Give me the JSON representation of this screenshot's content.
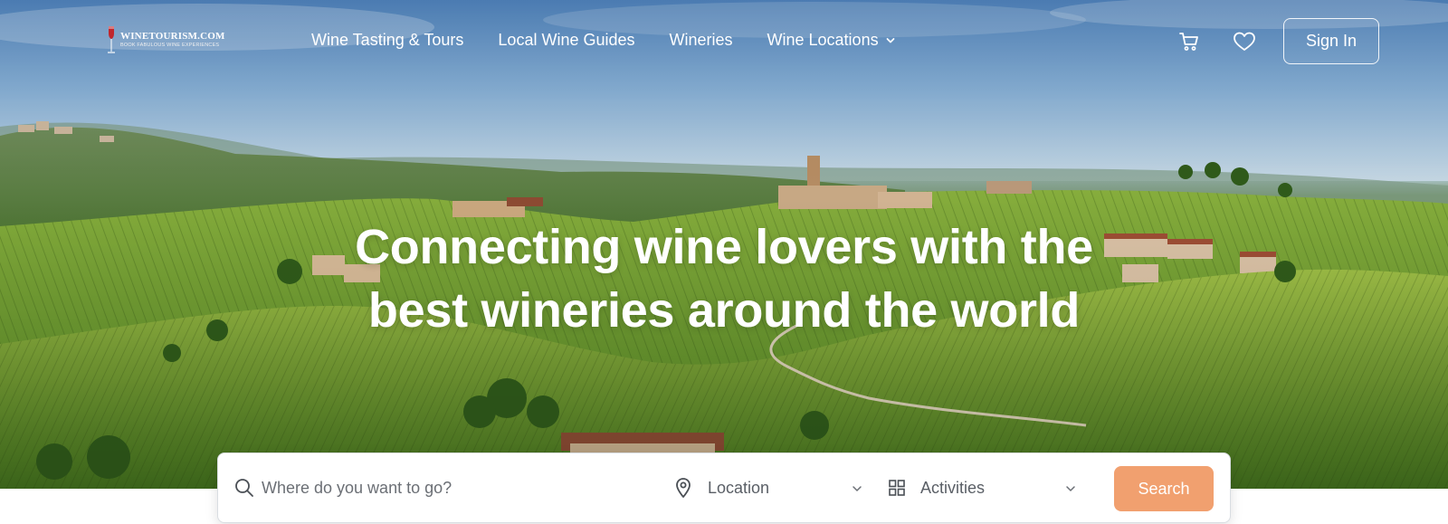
{
  "brand": {
    "name": "WINETOURISM.COM",
    "tagline": "BOOK FABULOUS WINE EXPERIENCES"
  },
  "nav": {
    "links": [
      {
        "label": "Wine Tasting & Tours"
      },
      {
        "label": "Local Wine Guides"
      },
      {
        "label": "Wineries"
      },
      {
        "label": "Wine Locations",
        "has_dropdown": true
      }
    ],
    "sign_in_label": "Sign In",
    "icons": [
      "cart-icon",
      "heart-icon"
    ]
  },
  "hero": {
    "headline_line1": "Connecting wine lovers with the",
    "headline_line2": "best wineries around the world"
  },
  "search": {
    "placeholder": "Where do you want to go?",
    "value": "",
    "location_label": "Location",
    "activities_label": "Activities",
    "button_label": "Search"
  },
  "colors": {
    "accent": "#f1a06f",
    "text_light": "#ffffff",
    "input_text": "#5a5f66"
  }
}
